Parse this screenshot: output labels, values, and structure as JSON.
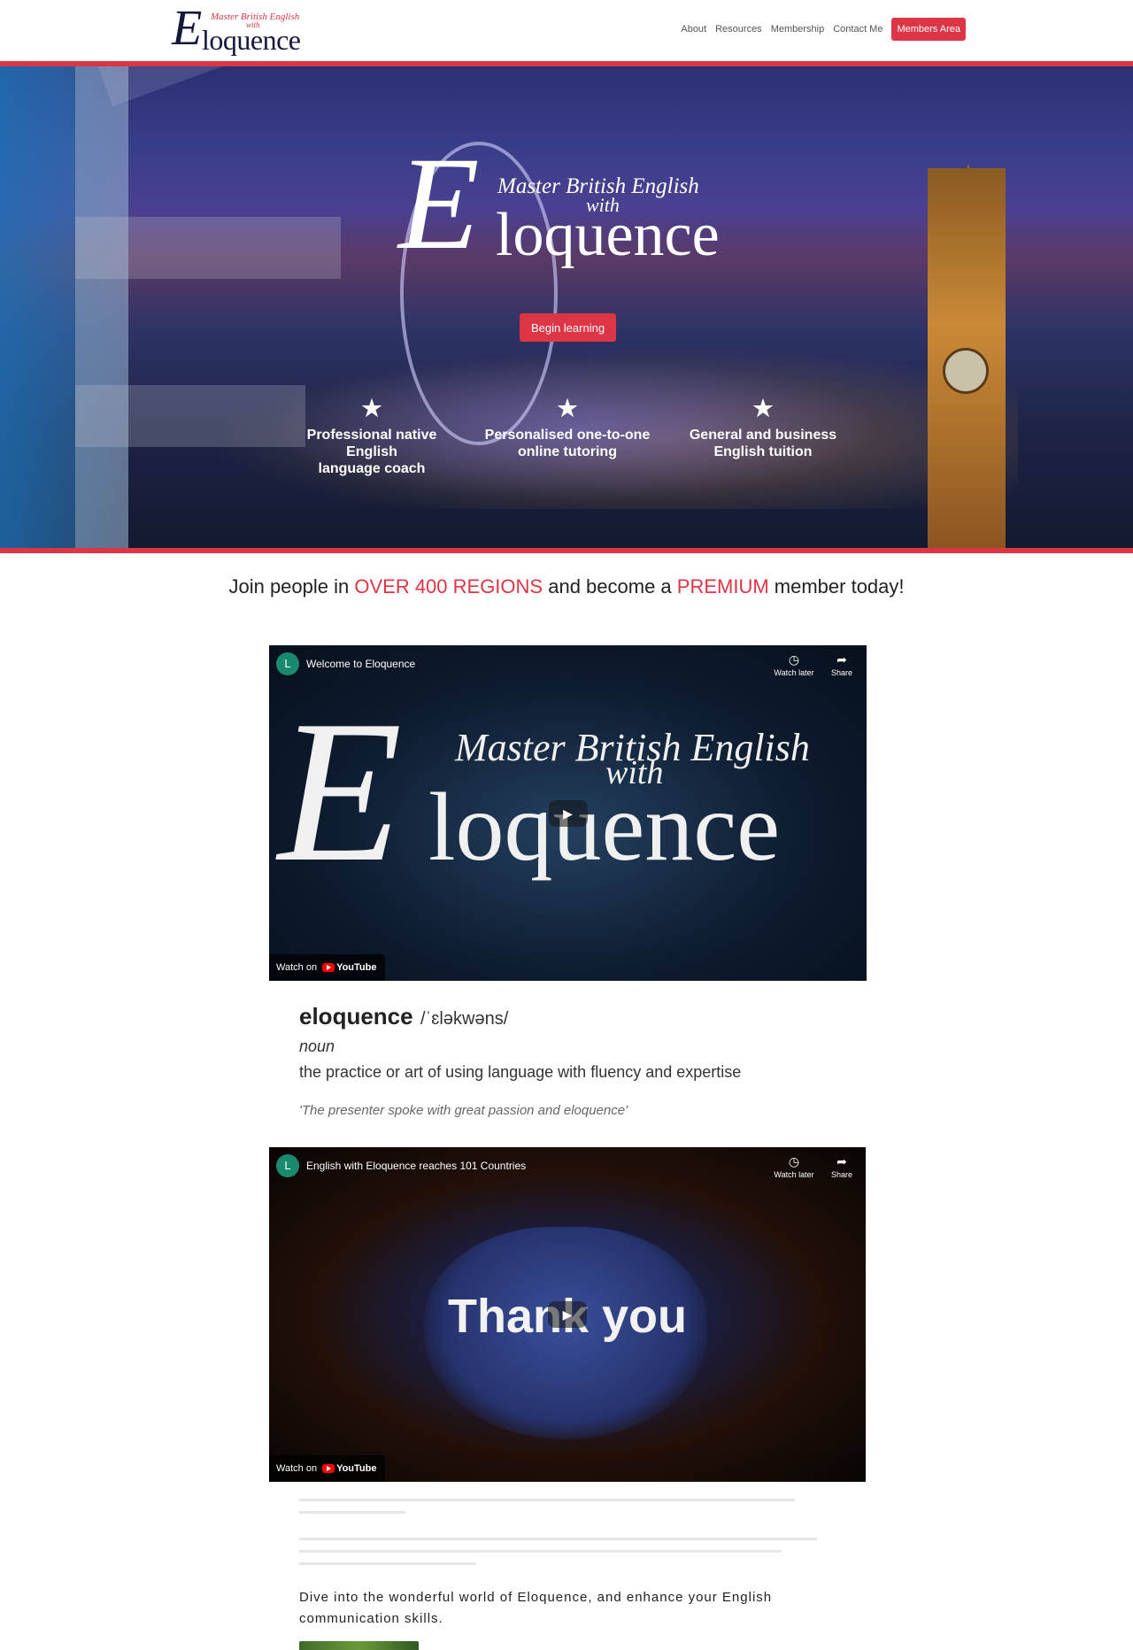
{
  "header": {
    "logo": {
      "letter": "E",
      "word": "loquence",
      "tagline_top": "Master British English",
      "tagline_with": "with"
    },
    "nav": [
      {
        "label": "About"
      },
      {
        "label": "Resources"
      },
      {
        "label": "Membership"
      },
      {
        "label": "Contact Me"
      }
    ],
    "members_button": "Members Area"
  },
  "hero": {
    "logo": {
      "letter": "E",
      "word": "loquence",
      "tagline_top": "Master British English",
      "tagline_with": "with"
    },
    "cta": "Begin learning",
    "features": [
      {
        "icon": "star-icon",
        "line1": "Professional native English",
        "line2": "language coach"
      },
      {
        "icon": "star-icon",
        "line1": "Personalised one-to-one",
        "line2": "online tutoring"
      },
      {
        "icon": "star-icon",
        "line1": "General and business",
        "line2": "English tuition"
      }
    ]
  },
  "tagline": {
    "part1": "Join people in ",
    "highlight1": "OVER 400 REGIONS",
    "part2": " and become a ",
    "highlight2": "PREMIUM",
    "part3": " member today!"
  },
  "videos": [
    {
      "avatar": "L",
      "title": "Welcome to Eloquence",
      "watch_later": "Watch later",
      "share": "Share",
      "watch_on": "Watch on",
      "youtube": "YouTube",
      "overlay": {
        "letter": "E",
        "word": "loquence",
        "tagline_top": "Master British English",
        "tagline_with": "with"
      }
    },
    {
      "avatar": "L",
      "title": "English with Eloquence reaches 101 Countries",
      "watch_later": "Watch later",
      "share": "Share",
      "watch_on": "Watch on",
      "youtube": "YouTube",
      "overlay_text": "Thank you"
    }
  ],
  "definition": {
    "word": "eloquence",
    "pronunciation": "/ˈɛləkwəns/",
    "part_of_speech": "noun",
    "meaning": "the practice or art of using language with fluency and expertise",
    "example": "'The presenter spoke with great passion and eloquence'"
  },
  "intro": {
    "dive": "Dive into the wonderful world of Eloquence, and enhance your English communication skills."
  },
  "colors": {
    "accent": "#dc3545",
    "navy": "#16173f"
  }
}
